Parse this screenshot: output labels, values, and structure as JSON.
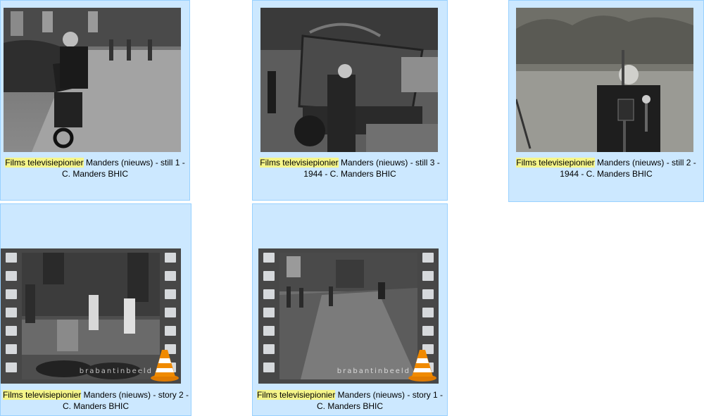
{
  "files": [
    {
      "highlight": "Films televisiepionier",
      "rest": " Manders (nieuws) - still 1 - C. Manders BHIC",
      "kind": "image",
      "icon": "photo-thumbnail"
    },
    {
      "highlight": "Films televisiepionier",
      "rest": " Manders (nieuws) - still 3 - 1944 - C. Manders BHIC",
      "kind": "image",
      "icon": "photo-thumbnail"
    },
    {
      "highlight": "Films televisiepionier",
      "rest": " Manders (nieuws) - still 2 - 1944 - C. Manders BHIC",
      "kind": "image",
      "icon": "photo-thumbnail"
    },
    {
      "highlight": "Films televisiepionier",
      "rest": " Manders (nieuws) - story 2 - C. Manders BHIC",
      "kind": "video",
      "icon": "vlc-cone-icon",
      "watermark": "brabantinbeeld"
    },
    {
      "highlight": "Films televisiepionier",
      "rest": " Manders (nieuws) - story 1 - C. Manders BHIC",
      "kind": "video",
      "icon": "vlc-cone-icon",
      "watermark": "brabantinbeeld"
    }
  ],
  "colors": {
    "selected_bg": "#cce8ff",
    "selected_border": "#99d1ff",
    "highlight": "#f5f58a",
    "vlc_orange": "#f08a00"
  }
}
